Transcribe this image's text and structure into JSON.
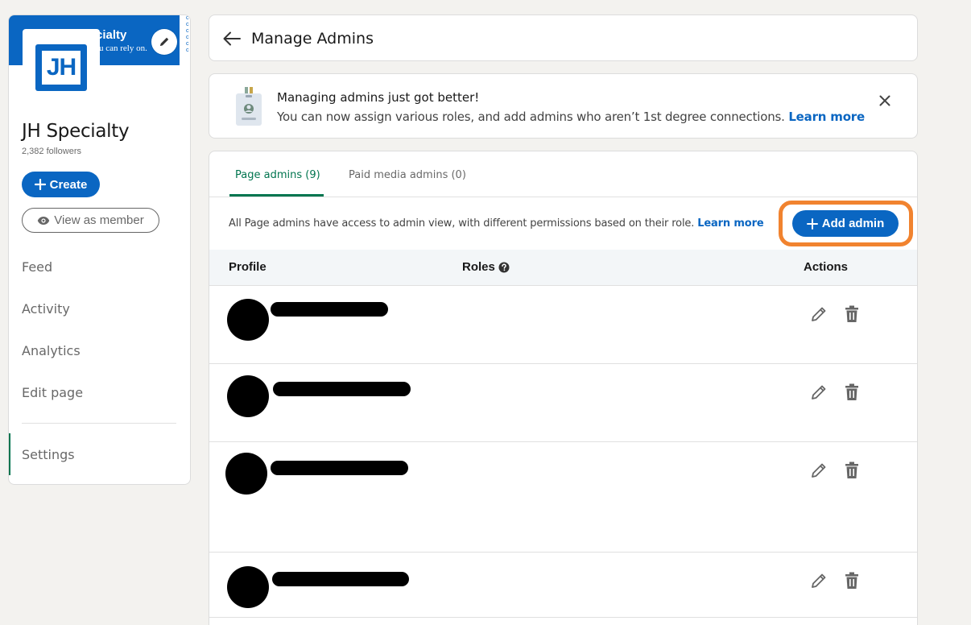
{
  "sidebar": {
    "cover": {
      "title": "cialty",
      "tagline": "u can rely on.",
      "edge_text": "c c c c c c"
    },
    "logo_text": "JH",
    "org_name": "JH Specialty",
    "followers": "2,382 followers",
    "create_label": "Create",
    "view_as_member_label": "View as member",
    "nav": [
      {
        "label": "Feed"
      },
      {
        "label": "Activity"
      },
      {
        "label": "Analytics"
      },
      {
        "label": "Edit page"
      },
      {
        "label": "Settings"
      }
    ]
  },
  "header": {
    "title": "Manage Admins"
  },
  "banner": {
    "title": "Managing admins just got better!",
    "text": "You can now assign various roles, and add admins who aren’t 1st degree connections.",
    "link": "Learn more"
  },
  "tabs": [
    {
      "label": "Page admins (9)"
    },
    {
      "label": "Paid media admins (0)"
    }
  ],
  "info": {
    "text": "All Page admins have access to admin view, with different permissions based on their role.",
    "link": "Learn more"
  },
  "add_admin_label": "Add admin",
  "table": {
    "headers": {
      "profile": "Profile",
      "roles": "Roles",
      "actions": "Actions"
    }
  },
  "colors": {
    "accent_blue": "#0a66c2",
    "active_green": "#01754f",
    "highlight_orange": "#f1832f",
    "page_bg": "#f3f2ef"
  },
  "icons": {
    "back": "arrow-left-icon",
    "close": "close-icon",
    "help": "question-circle-icon",
    "edit": "pencil-icon",
    "delete": "trash-icon",
    "eye": "eye-icon",
    "plus": "plus-icon"
  }
}
